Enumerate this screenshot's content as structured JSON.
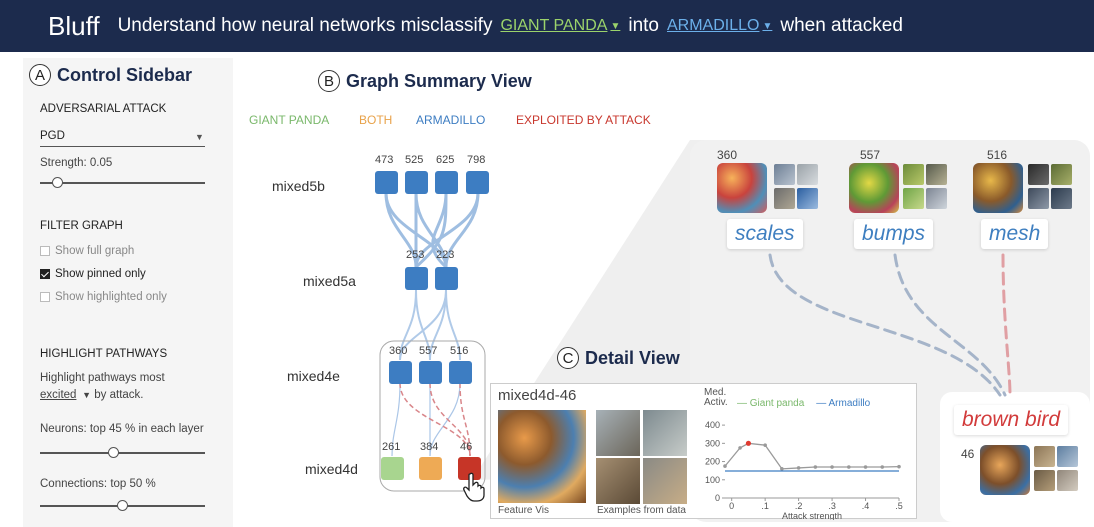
{
  "header": {
    "brand": "Bluff",
    "headline_prefix": "Understand how neural networks misclassify",
    "source_class": "GIANT PANDA",
    "connector": "into",
    "target_class": "ARMADILLO",
    "headline_suffix": "when attacked"
  },
  "sidebar": {
    "letter": "A",
    "title": "Control Sidebar",
    "attack_heading": "ADVERSARIAL ATTACK",
    "attack_method": "PGD",
    "strength_label": "Strength: 0.05",
    "strength_level": 0.08,
    "filter_heading": "FILTER GRAPH",
    "filters": [
      {
        "label": "Show full graph",
        "checked": false
      },
      {
        "label": "Show pinned only",
        "checked": true
      },
      {
        "label": "Show highlighted only",
        "checked": false
      }
    ],
    "highlight_heading": "HIGHLIGHT PATHWAYS",
    "highlight_line1": "Highlight pathways most",
    "highlight_mode": "excited",
    "highlight_suffix": "by attack.",
    "neurons_label": "Neurons: top 45  % in each layer",
    "neurons_level": 0.45,
    "connections_label": "Connections: top 50  %",
    "connections_level": 0.5
  },
  "graph": {
    "letter": "B",
    "title": "Graph Summary View",
    "legend": [
      {
        "label": "GIANT PANDA",
        "color": "#7ab86b"
      },
      {
        "label": "BOTH",
        "color": "#e8a24a"
      },
      {
        "label": "ARMADILLO",
        "color": "#3d7dc2"
      },
      {
        "label": "EXPLOITED BY ATTACK",
        "color": "#c8372d"
      }
    ],
    "layers": [
      "mixed5b",
      "mixed5a",
      "mixed4e",
      "mixed4d"
    ],
    "mixed5b_counts": [
      "473",
      "525",
      "625",
      "798"
    ],
    "mixed5a_counts": [
      "253",
      "223"
    ],
    "mixed4e_counts": [
      "360",
      "557",
      "516"
    ],
    "mixed4d_counts": [
      "261",
      "384",
      "46"
    ],
    "colors": {
      "panda": "#a8d58f",
      "both": "#eeaa55",
      "armadillo": "#3d7dc2",
      "exploited": "#c63527"
    }
  },
  "concepts": {
    "counts": [
      "360",
      "557",
      "516"
    ],
    "labels": [
      "scales",
      "bumps",
      "mesh"
    ],
    "target_label": "brown bird",
    "target_count": "46"
  },
  "detail": {
    "letter": "C",
    "title": "Detail View",
    "neuron_name": "mixed4d-46",
    "featvis_caption": "Feature Vis",
    "examples_caption": "Examples from data",
    "chart": {
      "ylabel_line1": "Med.",
      "ylabel_line2": "Activ.",
      "legend_panda": "Giant panda",
      "legend_armadillo": "Armadillo",
      "xlabel": "Attack strength"
    }
  },
  "chart_data": {
    "type": "line",
    "title": "",
    "xlabel": "Attack strength",
    "ylabel": "Med. Activ.",
    "xticks": [
      "0",
      ".1",
      ".2",
      ".3",
      ".4",
      ".5"
    ],
    "yticks": [
      "0",
      "100",
      "200",
      "300",
      "400"
    ],
    "xlim": [
      -0.02,
      0.5
    ],
    "ylim": [
      0,
      450
    ],
    "x": [
      -0.02,
      0.025,
      0.05,
      0.1,
      0.15,
      0.2,
      0.25,
      0.3,
      0.35,
      0.4,
      0.45,
      0.5
    ],
    "series": [
      {
        "name": "Giant panda",
        "color": "#9a9a9a",
        "values": [
          175,
          275,
          300,
          290,
          160,
          165,
          170,
          170,
          170,
          170,
          170,
          172
        ],
        "highlight_index": 2
      },
      {
        "name": "Armadillo",
        "color": "#3d7dc2",
        "values": [
          148,
          148,
          148,
          148,
          148,
          148,
          148,
          148,
          148,
          148,
          148,
          148
        ]
      }
    ]
  }
}
